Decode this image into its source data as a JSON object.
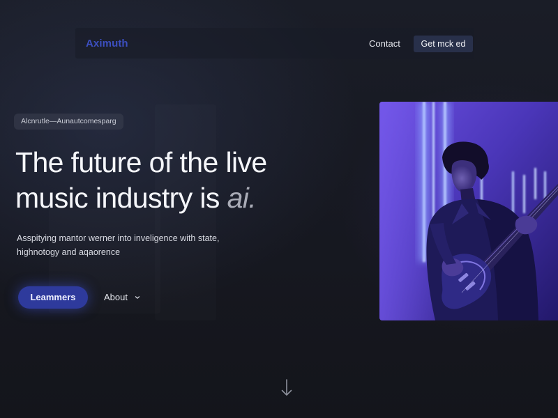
{
  "header": {
    "logo": "Aximuth",
    "nav": {
      "contact_label": "Contact",
      "cta_label": "Get mck ed"
    }
  },
  "hero": {
    "tag": "Alcnrutle—Aunautcomesparg",
    "title_line1": "The future of the live",
    "title_line2_prefix": "music industry is ",
    "title_accent": "ai.",
    "subtitle_line1": "Asspityіng mantor werner into inveligence with state,",
    "subtitle_line2": "highnotogy and aqaorence",
    "primary_button": "Leammers",
    "secondary_link": "About"
  },
  "image": {
    "subject": "musician playing electric guitar under purple neon light"
  },
  "icons": {
    "about_dropdown": "chevron-down-icon",
    "scroll": "arrow-down-icon"
  },
  "colors": {
    "background": "#171922",
    "brand": "#3c4fc0",
    "primary_button": "#2e3a9c",
    "cta_bg": "#28304a",
    "image_tint": "#5a3fc0"
  }
}
